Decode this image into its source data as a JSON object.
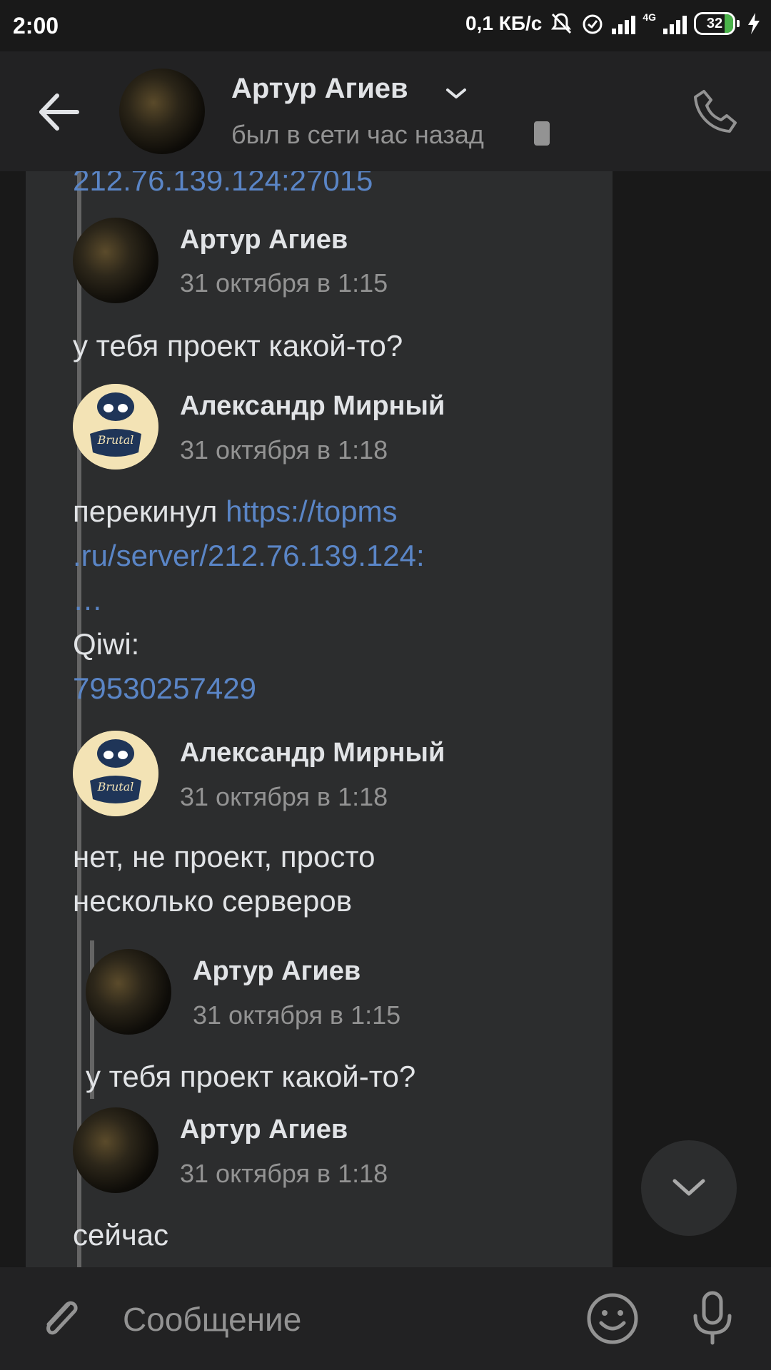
{
  "status_bar": {
    "time": "2:00",
    "speed": "0,1 КБ/с",
    "network": "4G",
    "battery": "32"
  },
  "header": {
    "name": "Артур Агиев",
    "status": "был в сети час назад"
  },
  "chat": {
    "truncated_link": "212.76.139.124:27015",
    "messages": [
      {
        "author": "Артур Агиев",
        "date": "31 октября в 1:15",
        "text": "у тебя проект какой-то?"
      },
      {
        "author": "Александр Мирный",
        "date": "31 октября в 1:18",
        "text_prefix": "перекинул ",
        "link_line1": "https://topms",
        "link_line2": ".ru/server/212.76.139.124:",
        "link_line3": "…",
        "qiwi_label": "Qiwi:",
        "qiwi_number": "79530257429"
      },
      {
        "author": "Александр Мирный",
        "date": "31 октября в 1:18",
        "text_line1": "нет, не проект, просто",
        "text_line2": "несколько серверов"
      },
      {
        "author": "Артур Агиев",
        "date": "31 октября в 1:15",
        "text": "у тебя проект какой-то?"
      },
      {
        "author": "Артур Агиев",
        "date": "31 октября в 1:18",
        "text": "сейчас"
      }
    ]
  },
  "composer": {
    "placeholder": "Сообщение"
  },
  "colors": {
    "background": "#191919",
    "bubble": "#2c2d2e",
    "link": "#5a85c6",
    "secondary_text": "#939393"
  }
}
